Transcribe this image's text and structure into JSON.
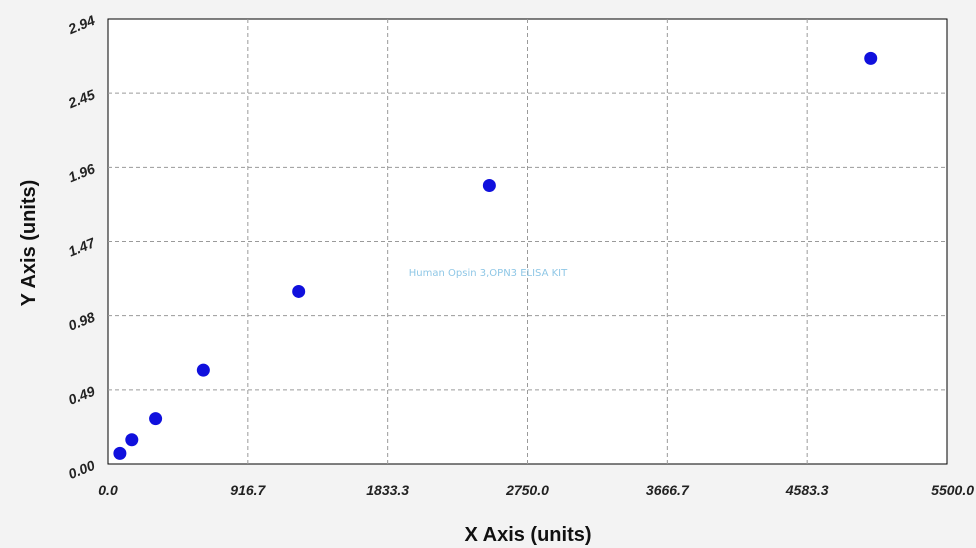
{
  "chart_data": {
    "type": "scatter",
    "title": "",
    "watermark": "Human Opsin 3,OPN3 ELISA KIT",
    "xlabel": "X Axis (units)",
    "ylabel": "Y Axis (units)",
    "xlim": [
      0,
      5500
    ],
    "ylim": [
      0,
      2.94
    ],
    "xticks": [
      "0.0",
      "916.7",
      "1833.3",
      "2750.0",
      "3666.7",
      "4583.3",
      "5500.0"
    ],
    "yticks": [
      "0.00",
      "0.49",
      "0.98",
      "1.47",
      "1.96",
      "2.45",
      "2.94"
    ],
    "grid": true,
    "marker_color": "#1010dd",
    "series": [
      {
        "x": [
          78,
          156,
          312,
          625,
          1250,
          2500,
          5000
        ],
        "y": [
          0.07,
          0.16,
          0.3,
          0.62,
          1.14,
          1.84,
          2.68
        ]
      }
    ]
  }
}
